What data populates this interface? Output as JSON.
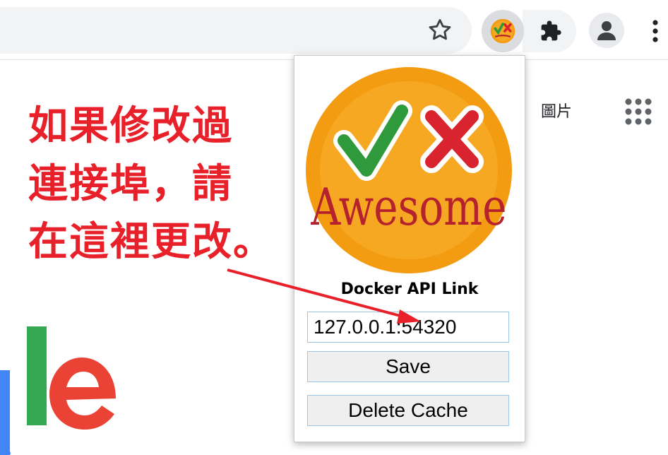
{
  "toolbar": {
    "icons": [
      "star-icon",
      "awesome-extension-icon",
      "puzzle-icon",
      "avatar-icon",
      "menu-icon"
    ]
  },
  "page": {
    "images_link": "圖片",
    "apps_icon": "apps-grid-icon"
  },
  "annotation": {
    "lines": [
      "如果修改過",
      "連接埠，請",
      "在這裡更改。"
    ],
    "color": "#e8202a"
  },
  "popup": {
    "logo_text": "Awesome",
    "title": "Docker API Link",
    "link_value": "127.0.0.1:54320",
    "save_label": "Save",
    "delete_label": "Delete Cache"
  },
  "colors": {
    "logo_orange": "#f39c12",
    "logo_inner": "#f7a823",
    "check_green": "#2e9a3c",
    "cross_red": "#d9232e",
    "google_blue": "#4285f4",
    "google_green": "#34a853",
    "google_red": "#ea4335"
  }
}
